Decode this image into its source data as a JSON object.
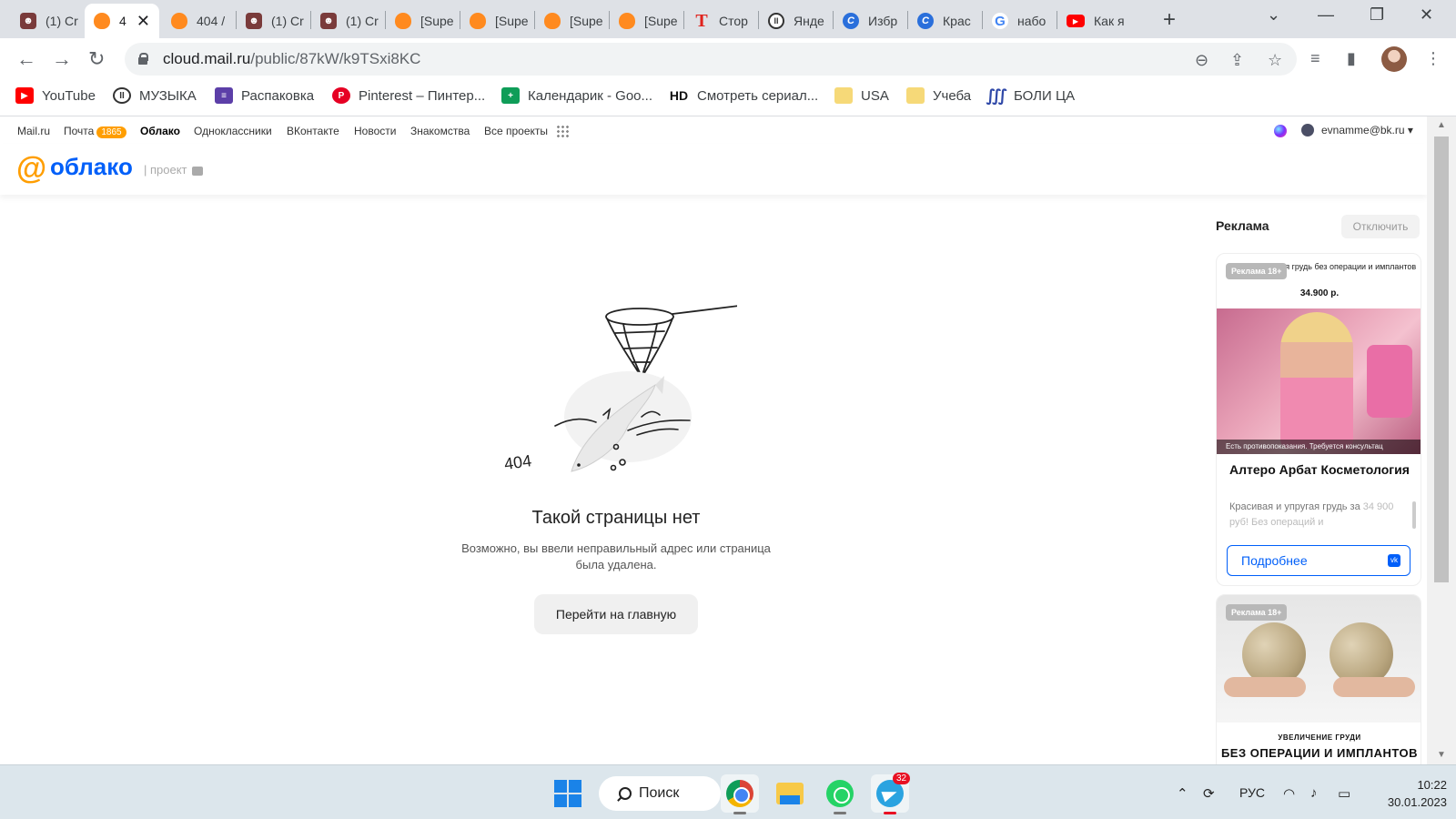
{
  "browser": {
    "tabs": [
      {
        "title": "(1) Cr",
        "icon": "mask-icon"
      },
      {
        "title": "4",
        "icon": "cloud-icon",
        "active": true
      },
      {
        "title": "404 /",
        "icon": "cloud-icon"
      },
      {
        "title": "(1) Cr",
        "icon": "mask-icon"
      },
      {
        "title": "(1) Cr",
        "icon": "mask-icon"
      },
      {
        "title": "[Supe",
        "icon": "cloud-icon"
      },
      {
        "title": "[Supe",
        "icon": "cloud-icon"
      },
      {
        "title": "[Supe",
        "icon": "cloud-icon"
      },
      {
        "title": "[Supe",
        "icon": "cloud-icon"
      },
      {
        "title": "Стор",
        "icon": "t-icon"
      },
      {
        "title": "Янде",
        "icon": "yandex-icon"
      },
      {
        "title": "Избр",
        "icon": "canva-icon"
      },
      {
        "title": "Крас",
        "icon": "canva-icon"
      },
      {
        "title": "набо",
        "icon": "google-icon"
      },
      {
        "title": "Как я",
        "icon": "youtube-icon"
      }
    ],
    "address": {
      "host": "cloud.mail.ru",
      "path": "/public/87kW/k9TSxi8KC"
    },
    "bookmarks": [
      {
        "label": "YouTube",
        "icon": "youtube-icon"
      },
      {
        "label": "МУЗЫКА",
        "icon": "yandex-icon"
      },
      {
        "label": "Распаковка",
        "icon": "list-icon"
      },
      {
        "label": "Pinterest – Пинтер...",
        "icon": "pinterest-icon"
      },
      {
        "label": "Календарик - Goo...",
        "icon": "calendar-icon"
      },
      {
        "label": "Смотреть сериал...",
        "icon": "hd-icon",
        "icon_text": "HD"
      },
      {
        "label": "USA",
        "icon": "folder-icon"
      },
      {
        "label": "Учеба",
        "icon": "folder-icon"
      },
      {
        "label": "БОЛИ ЦА",
        "icon": "boli-icon"
      }
    ]
  },
  "portal": {
    "links": [
      "Mail.ru",
      "Почта",
      "Облако",
      "Одноклассники",
      "ВКонтакте",
      "Новости",
      "Знакомства",
      "Все проекты"
    ],
    "mail_badge": "1865",
    "user_email": "evnamme@bk.ru ▾"
  },
  "logo": {
    "at": "@",
    "word": "облако",
    "project": "| проект"
  },
  "error": {
    "code": "404",
    "title": "Такой страницы нет",
    "description": "Возможно, вы ввели неправильный адрес или страница была удалена.",
    "button": "Перейти на главную"
  },
  "ads": {
    "title": "Реклама",
    "disable": "Отключить",
    "card1": {
      "badge": "Реклама 18+",
      "headline": "Красивая грудь без операции и имплантов",
      "price": "34.900 р.",
      "caption": "Есть противопоказания. Требуется консультац",
      "name": "Алтеро Арбат Косметология",
      "text": "Красивая и упругая грудь за",
      "text_fade": "34 900 руб! Без операций и",
      "button": "Подробнее"
    },
    "card2": {
      "badge": "Реклама 18+",
      "sub": "УВЕЛИЧЕНИЕ ГРУДИ",
      "headline": "БЕЗ ОПЕРАЦИИ И ИМПЛАНТОВ"
    }
  },
  "taskbar": {
    "search": "Поиск",
    "telegram_badge": "32",
    "lang": "РУС",
    "time": "10:22",
    "date": "30.01.2023"
  }
}
